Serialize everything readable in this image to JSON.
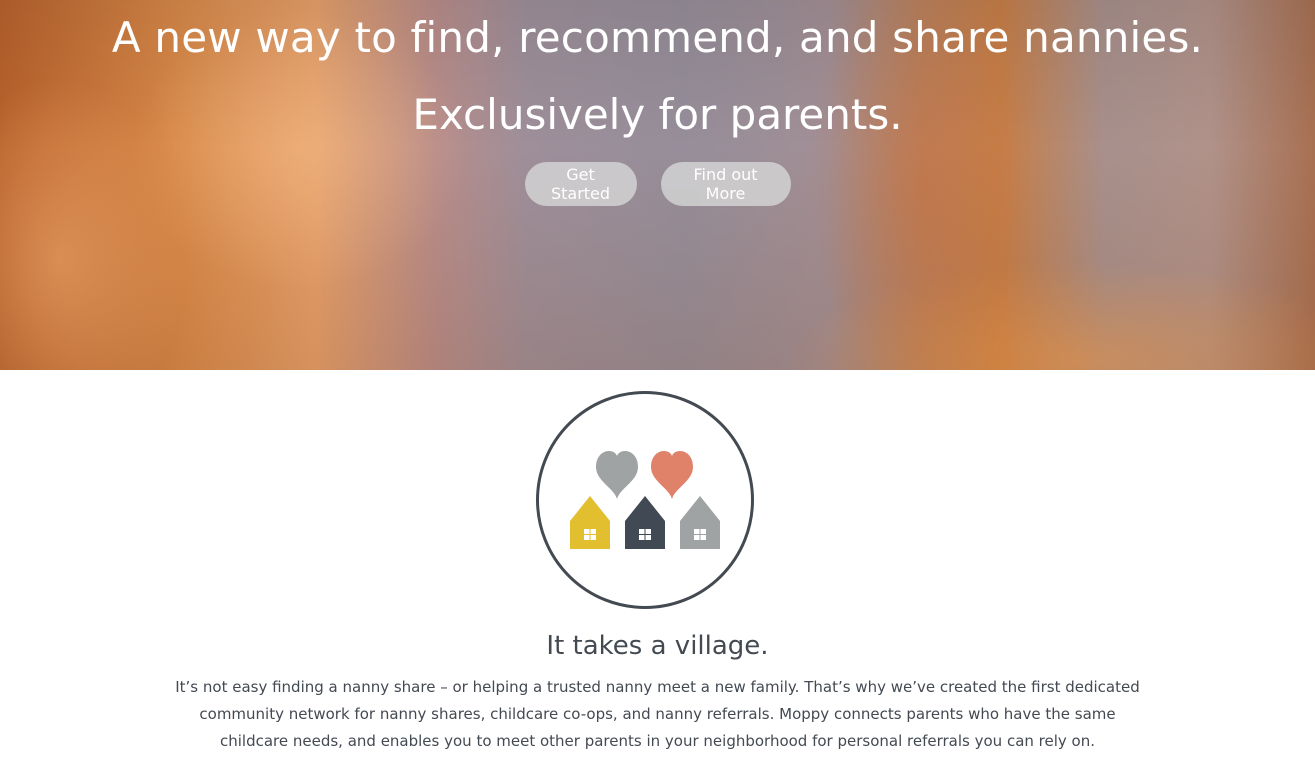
{
  "hero": {
    "title": "A new way to find, recommend, and share nannies.",
    "subtitle": "Exclusively for parents.",
    "buttons": {
      "get_started": "Get Started",
      "find_out_more": "Find out More"
    }
  },
  "village": {
    "logo_icon": "hearts-and-houses-icon",
    "colors": {
      "heart_left": "#a0a3a3",
      "heart_right": "#e0816a",
      "house_yellow": "#e2bf2e",
      "house_dark": "#414955",
      "house_gray": "#a0a3a3",
      "circle": "#444a52"
    },
    "title": "It takes a village.",
    "description": "It’s not easy finding a nanny share – or helping a trusted nanny meet a new family. That’s why we’ve created the first dedicated community network for nanny shares, childcare co-ops, and nanny referrals. Moppy connects parents who have the same childcare needs, and enables you to meet other parents in your neighborhood for personal referrals you can rely on."
  }
}
